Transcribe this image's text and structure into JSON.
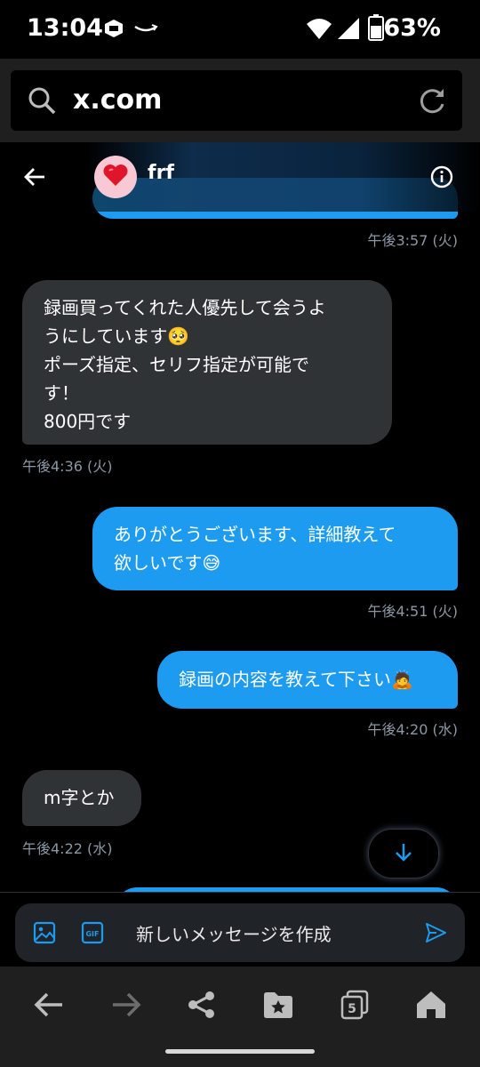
{
  "status_bar": {
    "time": "13:04",
    "battery": "63%"
  },
  "browser": {
    "url": "x.com",
    "tabs_count": "5"
  },
  "chat": {
    "name": "frf",
    "accent_color": "#1d9bf0",
    "messages": [
      {
        "from": "me",
        "text": "",
        "time": "午後3:57 (火)"
      },
      {
        "from": "them",
        "lines": [
          "録画買ってくれた人優先して会うよ",
          "うにしています🥺",
          "ポーズ指定、セリフ指定が可能で",
          "す！",
          "800円です"
        ],
        "time": "午後4:36 (火)"
      },
      {
        "from": "me",
        "lines": [
          "ありがとうございます、詳細教えて",
          "欲しいです😅"
        ],
        "time": "午後4:51 (火)"
      },
      {
        "from": "me",
        "lines": [
          "録画の内容を教えて下さい🙇"
        ],
        "time": "午後4:20 (水)"
      },
      {
        "from": "them",
        "lines": [
          "m字とか"
        ],
        "time": "午後4:22 (水)"
      }
    ]
  },
  "composer": {
    "placeholder": "新しいメッセージを作成"
  },
  "icons": {
    "search": "search-icon",
    "reload": "reload-icon",
    "back": "back-arrow-icon",
    "info": "info-icon",
    "image": "image-icon",
    "gif": "gif-icon",
    "send": "send-icon",
    "scroll_down": "arrow-down-icon",
    "nav_back": "back-icon",
    "nav_forward": "forward-icon",
    "share": "share-icon",
    "bookmarks": "bookmark-folder-icon",
    "tabs": "tabs-icon",
    "home": "home-icon"
  }
}
